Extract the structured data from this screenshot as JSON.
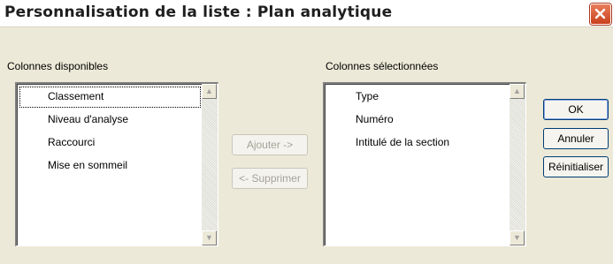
{
  "dialog": {
    "title": "Personnalisation de la liste : Plan analytique"
  },
  "available": {
    "label": "Colonnes disponibles",
    "items": [
      "Classement",
      "Niveau d'analyse",
      "Raccourci",
      "Mise en sommeil"
    ],
    "selected_index": 0
  },
  "chosen": {
    "label": "Colonnes sélectionnées",
    "items": [
      "Type",
      "Numéro",
      "Intitulé de la section"
    ]
  },
  "buttons": {
    "add": "Ajouter ->",
    "remove": "<- Supprimer",
    "ok": "OK",
    "cancel": "Annuler",
    "reset": "Réinitialiser"
  },
  "icons": {
    "close": "close-icon",
    "scroll_up": "arrow-up-icon",
    "scroll_down": "arrow-down-icon"
  },
  "colors": {
    "close_button": "#c9401c",
    "dialog_background": "#ece9d8",
    "button_border": "#003c74"
  }
}
